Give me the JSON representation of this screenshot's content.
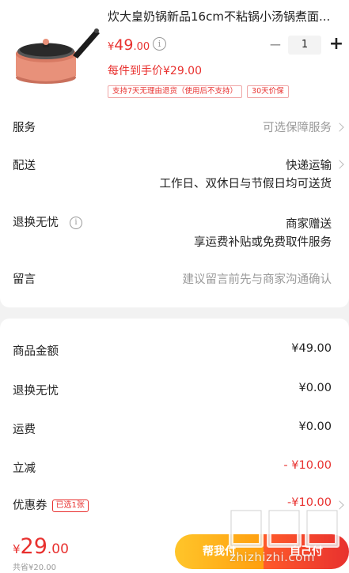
{
  "product": {
    "title": "炊大皇奶锅新品16cm不粘锅小汤锅煮面...",
    "price_currency": "¥",
    "price_int": "49",
    "price_dec": ".00",
    "quantity": "1",
    "hand_price": "每件到手价¥29.00",
    "tags": [
      "支持7天无理由退货（使用后不支持）",
      "30天价保"
    ]
  },
  "rows": {
    "service": {
      "label": "服务",
      "value": "可选保障服务"
    },
    "delivery": {
      "label": "配送",
      "value": "快递运输",
      "sub": "工作日、双休日与节假日均可送货"
    },
    "return": {
      "label": "退换无忧",
      "value": "商家赠送",
      "sub": "享运费补贴或免费取件服务"
    },
    "message": {
      "label": "留言",
      "placeholder": "建议留言前先与商家沟通确认"
    }
  },
  "summary": {
    "goods_amount": {
      "label": "商品金额",
      "value": "¥49.00"
    },
    "return_free": {
      "label": "退换无忧",
      "value": "¥0.00"
    },
    "shipping": {
      "label": "运费",
      "value": "¥0.00"
    },
    "discount": {
      "label": "立减",
      "value": "- ¥10.00"
    },
    "coupon": {
      "label": "优惠券",
      "tag": "已选1张",
      "value": "-¥10.00"
    }
  },
  "bottom": {
    "total_currency": "¥",
    "total_int": "29",
    "total_dec": ".00",
    "saved": "共省¥20.00",
    "help_pay": "帮我付",
    "self_pay": "自己付"
  },
  "watermark": "zhizhizhi.com",
  "colors": {
    "accent_red": "#e8312f",
    "help_pay_yellow": "#ffb81c",
    "pot_color": "#e8917a"
  }
}
